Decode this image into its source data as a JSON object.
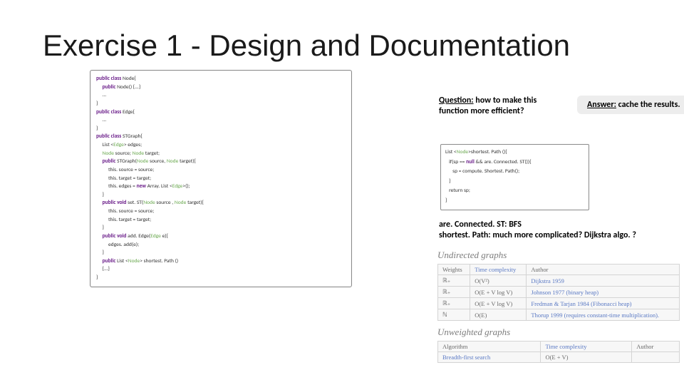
{
  "title": "Exercise 1 - Design and Documentation",
  "code_left": {
    "l1a": "public class ",
    "l1b": "Node{",
    "l2a": "     public ",
    "l2b": "Node() {...}",
    "l3": "     ...",
    "l4": "}",
    "l5a": "public class ",
    "l5b": "Edge{",
    "l6": "     ...",
    "l7": "}",
    "l8a": "public class ",
    "l8b": "STGraph{",
    "l9a": "     List <",
    "l9b": "Edge",
    "l9c": "> edges;",
    "l10a": "     Node ",
    "l10b": "source; ",
    "l10c": "Node ",
    "l10d": "target;",
    "l11a": "     public ",
    "l11b": "STGraph(",
    "l11c": "Node ",
    "l11d": "source, ",
    "l11e": "Node ",
    "l11f": "target){",
    "l12": "          this. source = source;",
    "l13": "          this. target = target;",
    "l14a": "          this. edges = ",
    "l14b": "new ",
    "l14c": "Array. List <",
    "l14d": "Edge",
    "l14e": ">();",
    "l15": "     }",
    "l16a": "     public void ",
    "l16b": "set. ST(",
    "l16c": "Node ",
    "l16d": "source , ",
    "l16e": "Node ",
    "l16f": "target){",
    "l17": "          this. source = source;",
    "l18": "          this. target = target;",
    "l19": "     }",
    "l20a": "     public void ",
    "l20b": "add. Edge(",
    "l20c": "Edge ",
    "l20d": "e){",
    "l21": "          edges. add(e);",
    "l22": "     }",
    "l23a": "     public ",
    "l23b": "List <",
    "l23c": "Node",
    "l23d": "> shortest. Path ()",
    "l24": "     {...}",
    "l25": "}"
  },
  "question_label": "Question:",
  "question_text": " how to make this function more efficient?",
  "answer_label": "Answer:",
  "answer_text": " cache the results.",
  "code_right": {
    "r1a": "List <",
    "r1b": "Node",
    "r1c": ">shortest. Path (){",
    "r2a": "   if(sp == ",
    "r2b": "null ",
    "r2c": "&& are. Connected. ST()){",
    "r3": "      sp = compute. Shortest. Path();",
    "r4": "   }",
    "r5": "   return sp;",
    "r6": "}"
  },
  "note": {
    "n1_bold": "are. Connected. ST:",
    "n1_rest": " BFS",
    "n2_bold": "shortest. Path:",
    "n2_rest": " much more complicated? Dijkstra algo. ?"
  },
  "tables": {
    "cap1": "Undirected graphs",
    "t1_headers": {
      "h1": "Weights",
      "h2": "Time complexity",
      "h3": "Author"
    },
    "t1_rows": [
      {
        "c1": "ℝ₊",
        "c2": "O(V²)",
        "c3": "Dijkstra 1959"
      },
      {
        "c1": "ℝ₊",
        "c2": "O(E + V log V)",
        "c3": "Johnson 1977 (binary heap)"
      },
      {
        "c1": "ℝ₊",
        "c2": "O(E + V log V)",
        "c3": "Fredman & Tarjan 1984 (Fibonacci heap)"
      },
      {
        "c1": "ℕ",
        "c2": "O(E)",
        "c3": "Thorup 1999 (requires constant-time multiplication)."
      }
    ],
    "cap2": "Unweighted graphs",
    "t2_headers": {
      "h1": "Algorithm",
      "h2": "Time complexity",
      "h3": "Author"
    },
    "t2_rows": [
      {
        "c1": "Breadth-first search",
        "c2": "O(E + V)",
        "c3": ""
      }
    ]
  }
}
